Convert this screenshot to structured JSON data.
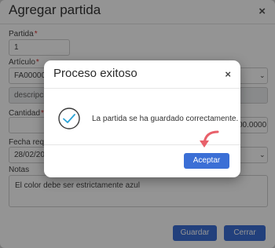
{
  "dialog": {
    "title": "Agregar partida",
    "close_symbol": "×",
    "fields": {
      "partida_label": "Partida",
      "partida_value": "1",
      "articulo_label": "Artículo",
      "articulo_value": "FA000000",
      "descripcion_value": "descripcio",
      "cantidad_label": "Cantidad",
      "cantidad_value": "00.0000",
      "fecha_label": "Fecha requ",
      "fecha_value": "28/02/20",
      "notas_label": "Notas",
      "notas_value": "El color debe ser estrictamente azul",
      "required_marker": "*"
    },
    "buttons": {
      "guardar": "Guardar",
      "cerrar": "Cerrar"
    }
  },
  "modal": {
    "title": "Proceso exitoso",
    "close_symbol": "×",
    "message": "La partida se ha guardado correctamente.",
    "accept_label": "Aceptar",
    "icon": "check-circle-icon",
    "pointer_icon": "curved-arrow-icon"
  },
  "colors": {
    "primary": "#3b6fd6",
    "required": "#d32f2f",
    "check": "#2aa3d6",
    "arrow": "#e8606a"
  }
}
